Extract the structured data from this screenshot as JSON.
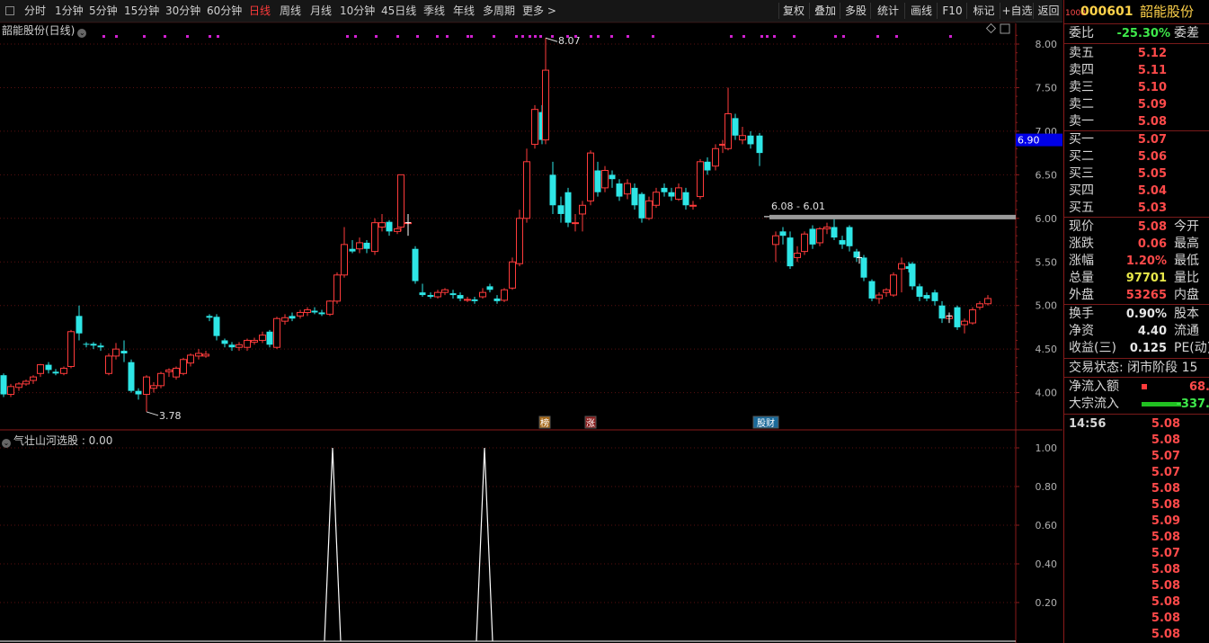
{
  "toolbar": {
    "periods": [
      "分时",
      "1分钟",
      "5分钟",
      "15分钟",
      "30分钟",
      "60分钟",
      "日线",
      "周线",
      "月线",
      "10分钟",
      "45日线",
      "季线",
      "年线",
      "多周期",
      "更多 >"
    ],
    "active_index": 6,
    "right_buttons": [
      "复权",
      "叠加",
      "多股",
      "统计",
      "画线",
      "F10",
      "标记",
      "+自选",
      "返回"
    ]
  },
  "chart": {
    "title": "韶能股份(日线)",
    "price_ticks": [
      "8.00",
      "7.50",
      "7.00",
      "6.50",
      "6.00",
      "5.50",
      "5.00",
      "4.50",
      "4.00"
    ],
    "current_price_badge": "6.90",
    "high_label": "8.07",
    "low_label": "3.78",
    "range_label": "6.08 - 6.01",
    "markers": [
      "榜",
      "涨",
      "股财"
    ]
  },
  "indicator": {
    "title": "气壮山河选股 : 0.00",
    "ticks": [
      "1.00",
      "0.80",
      "0.60",
      "0.40",
      "0.20"
    ]
  },
  "panel": {
    "code_prefix": "1000",
    "code": "000601",
    "name": "韶能股份",
    "weibi_label": "委比",
    "weibi_value": "-25.30%",
    "weicha_label": "委差",
    "sell": [
      {
        "l": "卖五",
        "v": "5.12"
      },
      {
        "l": "卖四",
        "v": "5.11"
      },
      {
        "l": "卖三",
        "v": "5.10"
      },
      {
        "l": "卖二",
        "v": "5.09"
      },
      {
        "l": "卖一",
        "v": "5.08"
      }
    ],
    "buy": [
      {
        "l": "买一",
        "v": "5.07"
      },
      {
        "l": "买二",
        "v": "5.06"
      },
      {
        "l": "买三",
        "v": "5.05"
      },
      {
        "l": "买四",
        "v": "5.04"
      },
      {
        "l": "买五",
        "v": "5.03"
      }
    ],
    "quote": [
      {
        "l": "现价",
        "v": "5.08",
        "r": "今开",
        "c": "#ff4a4a"
      },
      {
        "l": "涨跌",
        "v": "0.06",
        "r": "最高",
        "c": "#ff4a4a"
      },
      {
        "l": "涨幅",
        "v": "1.20%",
        "r": "最低",
        "c": "#ff4a4a"
      },
      {
        "l": "总量",
        "v": "97701",
        "r": "量比",
        "c": "#e8e84a"
      },
      {
        "l": "外盘",
        "v": "53265",
        "r": "内盘",
        "c": "#ff4a4a"
      }
    ],
    "fin": [
      {
        "l": "换手",
        "v": "0.90%",
        "r": "股本"
      },
      {
        "l": "净资",
        "v": "4.40",
        "r": "流通"
      },
      {
        "l": "收益(三)",
        "v": "0.125",
        "r": "PE(动)"
      }
    ],
    "trade_status": "交易状态: 闭市阶段 15",
    "net_inflow_label": "净流入额",
    "net_inflow_value": "68.",
    "bulk_label": "大宗流入",
    "bulk_value": "-337.",
    "tick_time": "14:56",
    "ticks": [
      "5.08",
      "5.08",
      "5.07",
      "5.07",
      "5.08",
      "5.08",
      "5.09",
      "5.08",
      "5.07",
      "5.08",
      "5.08",
      "5.08",
      "5.08",
      "5.08"
    ]
  },
  "colors": {
    "up": "#ff3b3b",
    "down": "#2ee6e6",
    "grid": "#5a1010",
    "axis": "#8a1a1a",
    "magenta": "#d020d0"
  }
}
